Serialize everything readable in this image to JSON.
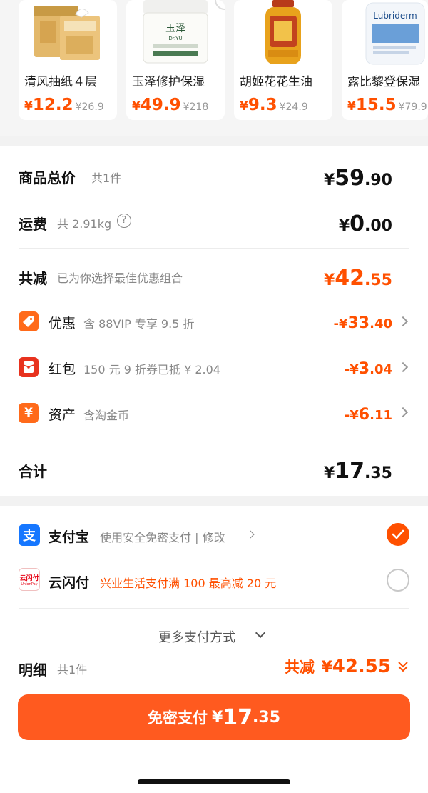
{
  "products": [
    {
      "name": "清风抽纸４层",
      "currency": "¥",
      "price_int": "12",
      "price_dec": ".2",
      "orig_price": "¥26.9"
    },
    {
      "name": "玉泽修护保湿",
      "currency": "¥",
      "price_int": "49",
      "price_dec": ".9",
      "orig_price": "¥218"
    },
    {
      "name": "胡姬花花生油",
      "currency": "¥",
      "price_int": "9",
      "price_dec": ".3",
      "orig_price": "¥24.9"
    },
    {
      "name": "露比黎登保湿",
      "currency": "¥",
      "price_int": "15",
      "price_dec": ".5",
      "orig_price": "¥79.9"
    }
  ],
  "product_images": {
    "yuze_brand": "玉泽",
    "yuze_brand_en": "Dr.YU",
    "lubriderm_brand": "Lubriderm"
  },
  "summary": {
    "total_label": "商品总价",
    "total_count": "共1件",
    "total_currency": "¥",
    "total_int": "59",
    "total_dec": ".90",
    "shipping_label": "运费",
    "shipping_weight": "共 2.91kg",
    "shipping_currency": "¥",
    "shipping_int": "0",
    "shipping_dec": ".00",
    "reduce_label": "共减",
    "reduce_desc": "已为你选择最佳优惠组合",
    "reduce_currency": "¥",
    "reduce_int": "42",
    "reduce_dec": ".55"
  },
  "discounts": [
    {
      "label": "优惠",
      "desc": "含 88VIP 专享 9.5 折",
      "prefix": "-¥",
      "int": "33",
      "dec": ".40",
      "icon": "tag-icon",
      "color": "#ff6a1a"
    },
    {
      "label": "红包",
      "desc": "150 元 9 折券已抵 ¥ 2.04",
      "prefix": "-¥",
      "int": "3",
      "dec": ".04",
      "icon": "red-packet-icon",
      "color": "#e8321e"
    },
    {
      "label": "资产",
      "desc": "含淘金币",
      "prefix": "-¥",
      "int": "6",
      "dec": ".11",
      "icon": "yen-coin-icon",
      "color": "#ff6a1a"
    }
  ],
  "grand_total": {
    "label": "合计",
    "currency": "¥",
    "int": "17",
    "dec": ".35"
  },
  "payment": {
    "alipay_label": "支付宝",
    "alipay_desc": "使用安全免密支付 | 修改",
    "unionpay_label": "云闪付",
    "unionpay_desc": "兴业生活支付满 100 最高减 20 元",
    "unionpay_icon_text": "云闪付",
    "unionpay_icon_sub": "UnionPay",
    "more_label": "更多支付方式"
  },
  "detail": {
    "label": "明细",
    "count": "共1件",
    "reduce_text": "共减",
    "currency": "¥",
    "amount": "42.55"
  },
  "submit": {
    "label": "免密支付",
    "currency": "¥",
    "int": "17",
    "dec": ".35"
  },
  "colors": {
    "accent": "#ff5000",
    "alipay": "#1677ff",
    "unionpay": "#e60012"
  }
}
